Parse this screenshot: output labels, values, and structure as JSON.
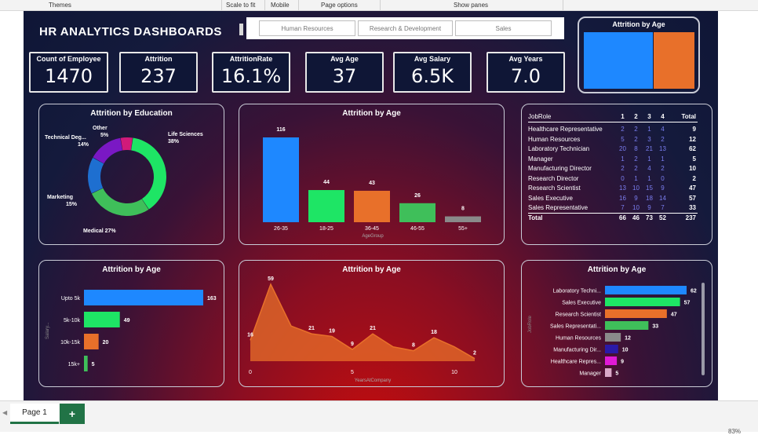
{
  "ribbon": {
    "themes": "Themes",
    "scale_to_fit": "Scale to fit",
    "mobile": "Mobile",
    "page_options": "Page options",
    "show_panes": "Show panes"
  },
  "dashboard": {
    "title": "HR ANALYTICS DASHBOARDS"
  },
  "slicer": {
    "options": [
      "Human Resources",
      "Research & Development",
      "Sales"
    ]
  },
  "kpis": [
    {
      "label": "Count of Employee",
      "value": "1470"
    },
    {
      "label": "Attrition",
      "value": "237"
    },
    {
      "label": "AttritionRate",
      "value": "16.1%"
    },
    {
      "label": "Avg Age",
      "value": "37"
    },
    {
      "label": "Avg Salary",
      "value": "6.5K"
    },
    {
      "label": "Avg Years",
      "value": "7.0"
    }
  ],
  "top_right_chart": {
    "title": "Attrition by Age",
    "colors": [
      "#1e88ff",
      "#e8702a"
    ]
  },
  "colors": {
    "blue": "#1e88ff",
    "green": "#1ee565",
    "orange": "#e8702a",
    "darkgreen": "#3fbf5a",
    "gray": "#8a8a8a",
    "purple": "#7a18c4",
    "navy": "#2a1aa8",
    "magenta": "#e01ad6",
    "pink": "#d9a8c8",
    "teal": "#1e5fa8"
  },
  "chart_data": [
    {
      "type": "pie",
      "title": "Attrition by Education",
      "labels": [
        "Life Sciences 38%",
        "Medical 27%",
        "Marketing 15%",
        "Technical Deg... 14%",
        "Other 5%"
      ],
      "values": [
        38,
        27,
        15,
        14,
        5
      ],
      "colors": [
        "#1ee565",
        "#3fbf5a",
        "#1e6fd0",
        "#7a18c4",
        "#d11a7a"
      ]
    },
    {
      "type": "bar",
      "title": "Attrition by Age",
      "xlabel": "AgeGroup",
      "categories": [
        "26-35",
        "18-25",
        "36-45",
        "46-55",
        "55+"
      ],
      "values": [
        116,
        44,
        43,
        26,
        8
      ],
      "colors": [
        "#1e88ff",
        "#1ee565",
        "#e8702a",
        "#3fbf5a",
        "#8a8a8a"
      ]
    },
    {
      "type": "table",
      "title": "JobRole",
      "columns": [
        "1",
        "2",
        "3",
        "4",
        "Total"
      ],
      "rows": [
        {
          "label": "Healthcare Representative",
          "values": [
            "2",
            "2",
            "1",
            "4",
            "9"
          ]
        },
        {
          "label": "Human Resources",
          "values": [
            "5",
            "2",
            "3",
            "2",
            "12"
          ]
        },
        {
          "label": "Laboratory Technician",
          "values": [
            "20",
            "8",
            "21",
            "13",
            "62"
          ]
        },
        {
          "label": "Manager",
          "values": [
            "1",
            "2",
            "1",
            "1",
            "5"
          ]
        },
        {
          "label": "Manufacturing Director",
          "values": [
            "2",
            "2",
            "4",
            "2",
            "10"
          ]
        },
        {
          "label": "Research Director",
          "values": [
            "0",
            "1",
            "1",
            "0",
            "2"
          ]
        },
        {
          "label": "Research Scientist",
          "values": [
            "13",
            "10",
            "15",
            "9",
            "47"
          ]
        },
        {
          "label": "Sales Executive",
          "values": [
            "16",
            "9",
            "18",
            "14",
            "57"
          ]
        },
        {
          "label": "Sales Representative",
          "values": [
            "7",
            "10",
            "9",
            "7",
            "33"
          ]
        }
      ],
      "total": {
        "label": "Total",
        "values": [
          "66",
          "46",
          "73",
          "52",
          "237"
        ]
      }
    },
    {
      "type": "bar",
      "title": "Attrition by Age",
      "orientation": "horizontal",
      "ylabel": "Salary...",
      "categories": [
        "Upto 5k",
        "5k-10k",
        "10k-15k",
        "15k+"
      ],
      "values": [
        163,
        49,
        20,
        5
      ],
      "colors": [
        "#1e88ff",
        "#1ee565",
        "#e8702a",
        "#3fbf5a"
      ]
    },
    {
      "type": "area",
      "title": "Attrition by Age",
      "xlabel": "YearsAtCompany",
      "x": [
        0,
        1,
        2,
        3,
        4,
        5,
        6,
        7,
        8,
        9,
        10,
        11
      ],
      "values": [
        16,
        59,
        27,
        21,
        19,
        9,
        21,
        11,
        8,
        18,
        11,
        2
      ],
      "xticks": [
        0,
        5,
        10
      ],
      "color": "#e8702a"
    },
    {
      "type": "bar",
      "title": "Attrition by Age",
      "orientation": "horizontal",
      "ylabel": "JobRole",
      "categories": [
        "Laboratory Techni...",
        "Sales Executive",
        "Research Scientist",
        "Sales Representati...",
        "Human Resources",
        "Manufacturing Dir...",
        "Healthcare Repres...",
        "Manager"
      ],
      "values": [
        62,
        57,
        47,
        33,
        12,
        10,
        9,
        5
      ],
      "colors": [
        "#1e88ff",
        "#1ee565",
        "#e8702a",
        "#3fbf5a",
        "#8a8a8a",
        "#2a1aa8",
        "#e01ad6",
        "#d9a8c8"
      ]
    }
  ],
  "status": {
    "page_tab": "Page 1",
    "add_page": "+",
    "zoom": "83%"
  }
}
